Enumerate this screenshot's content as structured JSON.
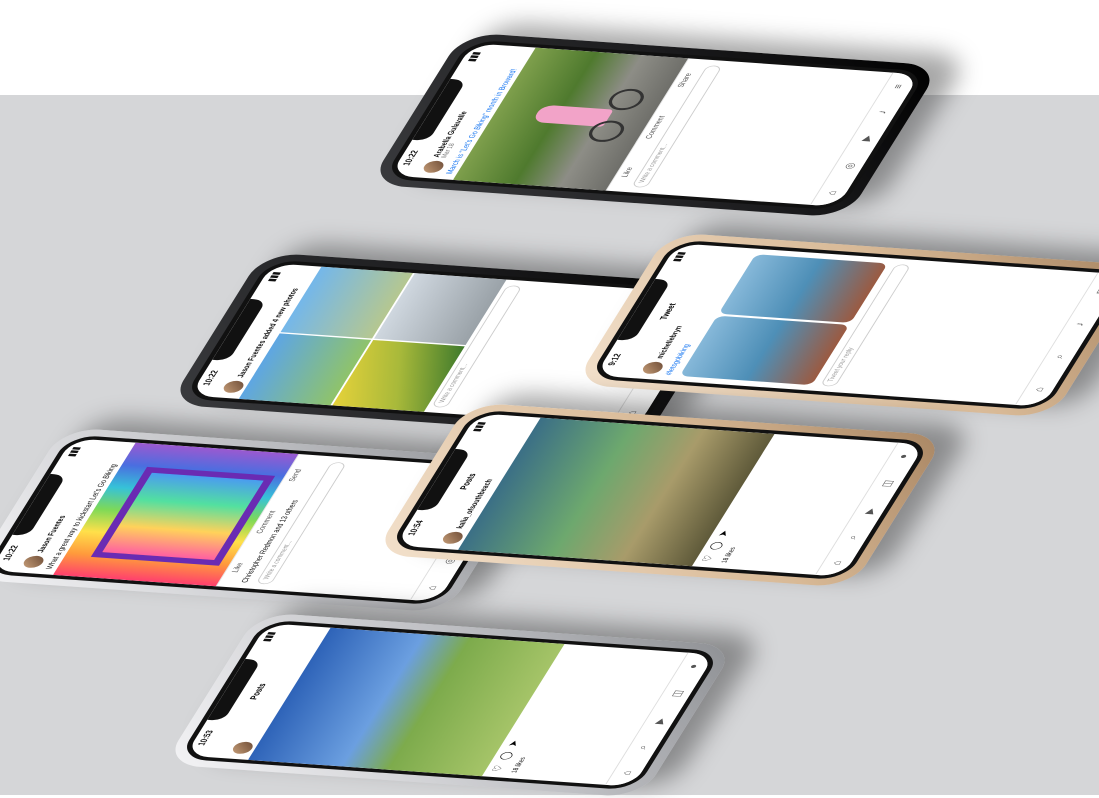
{
  "phones": {
    "p1": {
      "time": "10:22",
      "author": "Arabella Gulavalle",
      "meta": "Mar 18",
      "caption": "March is \"Let's Go Biking\" month in Broward!",
      "like": "Like",
      "comment": "Comment",
      "share": "Share",
      "input": "Write a comment..."
    },
    "p2": {
      "time": "10:22",
      "author": "Jason Fuentes added 4 new photos",
      "meta": "",
      "caption": "",
      "input": "Write a comment..."
    },
    "p3": {
      "time": "9:12",
      "header": "Tweet",
      "author": "michellebryn",
      "hashtags": "#letsgobiking",
      "input": "Tweet your reply"
    },
    "p4": {
      "time": "10:22",
      "author": "Jason Fuentes",
      "caption": "What a great way to kickstart Let's Go Biking",
      "like": "Like",
      "comment": "Comment",
      "send": "Send",
      "commenter": "Christopher Redmon and 13 others",
      "input": "Write a comment..."
    },
    "p5": {
      "time": "10:54",
      "header": "Posts",
      "author": "kalia_ofsouthbeach",
      "likes": "18 likes"
    },
    "p6": {
      "time": "10:53",
      "header": "Posts",
      "likes": "18 likes"
    }
  }
}
